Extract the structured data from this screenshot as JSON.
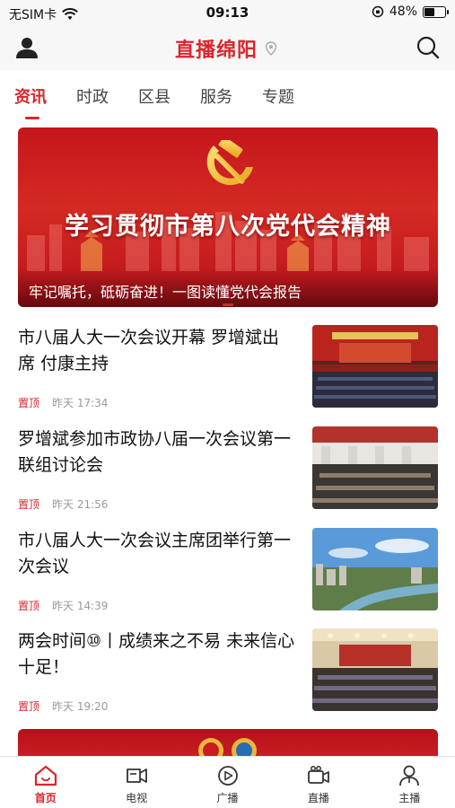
{
  "status_bar": {
    "carrier": "无SIM卡",
    "time": "09:13",
    "battery": "48%",
    "battery_level": 0.48
  },
  "header": {
    "title": "直播绵阳"
  },
  "tabs": [
    {
      "label": "资讯",
      "active": true
    },
    {
      "label": "时政",
      "active": false
    },
    {
      "label": "区县",
      "active": false
    },
    {
      "label": "服务",
      "active": false
    },
    {
      "label": "专题",
      "active": false
    }
  ],
  "banner": {
    "headline": "学习贯彻市第八次党代会精神",
    "caption": "牢记嘱托，砥砺奋进！一图读懂党代会报告"
  },
  "news": [
    {
      "title": "市八届人大一次会议开幕 罗增斌出席 付康主持",
      "tag": "置顶",
      "time": "昨天 17:34"
    },
    {
      "title": "罗增斌参加市政协八届一次会议第一联组讨论会",
      "tag": "置顶",
      "time": "昨天 21:56"
    },
    {
      "title": "市八届人大一次会议主席团举行第一次会议",
      "tag": "置顶",
      "time": "昨天 14:39"
    },
    {
      "title": "两会时间⑩丨成绩来之不易 未来信心十足！",
      "tag": "置顶",
      "time": "昨天 19:20"
    }
  ],
  "bottom_nav": [
    {
      "label": "首页",
      "icon": "home-icon",
      "active": true
    },
    {
      "label": "电视",
      "icon": "tv-icon",
      "active": false
    },
    {
      "label": "广播",
      "icon": "radio-play-icon",
      "active": false
    },
    {
      "label": "直播",
      "icon": "video-camera-icon",
      "active": false
    },
    {
      "label": "主播",
      "icon": "anchor-person-icon",
      "active": false
    }
  ],
  "colors": {
    "accent": "#d9262c",
    "banner_red": "#c4161c"
  }
}
